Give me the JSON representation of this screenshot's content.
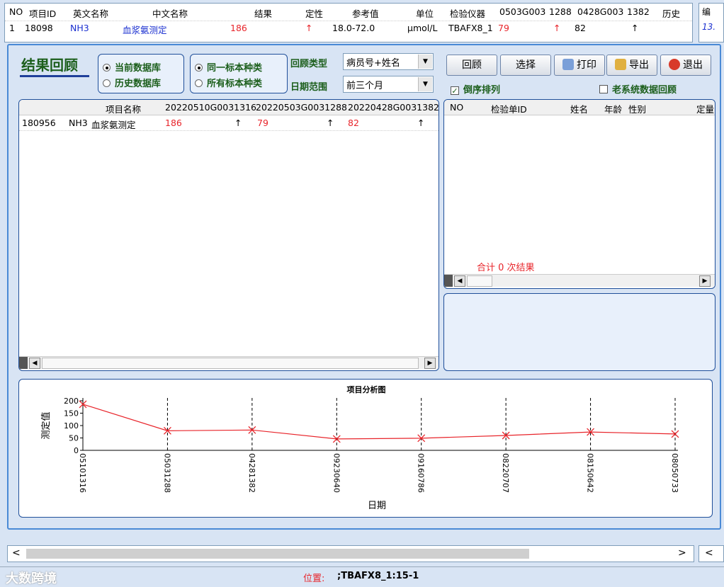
{
  "bg_table": {
    "headers": [
      "NO",
      "项目ID",
      "英文名称",
      "中文名称",
      "结果",
      "定性",
      "参考值",
      "单位",
      "检验仪器",
      "0503G003",
      "1288",
      "0428G003",
      "1382",
      "历史"
    ],
    "row": {
      "no": "1",
      "id": "18098",
      "en": "NH3",
      "cn": "血浆氨测定",
      "result": "186",
      "flag": "↑",
      "ref": "18.0-72.0",
      "unit": "μmol/L",
      "instrument": "TBAFX8_1",
      "h1": "79",
      "h1flag": "↑",
      "h2": "82",
      "h2flag": "↑"
    }
  },
  "right_panel": {
    "header": "编",
    "value": "13."
  },
  "dialog": {
    "title": "结果回顾",
    "db_options": [
      "当前数据库",
      "历史数据库"
    ],
    "sample_options": [
      "同一标本种类",
      "所有标本种类"
    ],
    "review_type_label": "回顾类型",
    "review_type_value": "病员号+姓名",
    "date_range_label": "日期范围",
    "date_range_value": "前三个月",
    "buttons": {
      "review": "回顾",
      "select": "选择",
      "print": "打印",
      "export": "导出",
      "exit": "退出"
    },
    "reverse_sort": "倒序排列",
    "old_system": "老系统数据回顾",
    "left_grid": {
      "headers": [
        "项目名称",
        "20220510G0031316",
        "20220503G0031288",
        "20220428G0031382"
      ],
      "row": {
        "id": "180956",
        "en": "NH3",
        "cn": "血浆氨测定",
        "v1": "186",
        "f1": "↑",
        "v2": "79",
        "f2": "↑",
        "v3": "82",
        "f3": "↑"
      }
    },
    "right_grid": {
      "headers": [
        "NO",
        "检验单ID",
        "姓名",
        "年龄",
        "性别",
        "定量"
      ],
      "total_text": "合计 0 次结果"
    }
  },
  "chart_data": {
    "type": "line",
    "title": "项目分析图",
    "xlabel": "日期",
    "ylabel": "测定值",
    "categories": [
      "05101316",
      "05031288",
      "04281382",
      "09230640",
      "09160786",
      "08220707",
      "08150642",
      "08050733"
    ],
    "series": [
      {
        "values": [
          186,
          79,
          82,
          46,
          49,
          60,
          74,
          66
        ]
      }
    ],
    "ylim": [
      0,
      200
    ],
    "yticks": [
      0,
      50,
      100,
      150,
      200
    ],
    "color": "#e8242a"
  },
  "status": {
    "watermark": "大数跨境",
    "position_label": "位置:",
    "position_value": ";TBAFX8_1:15-1"
  }
}
